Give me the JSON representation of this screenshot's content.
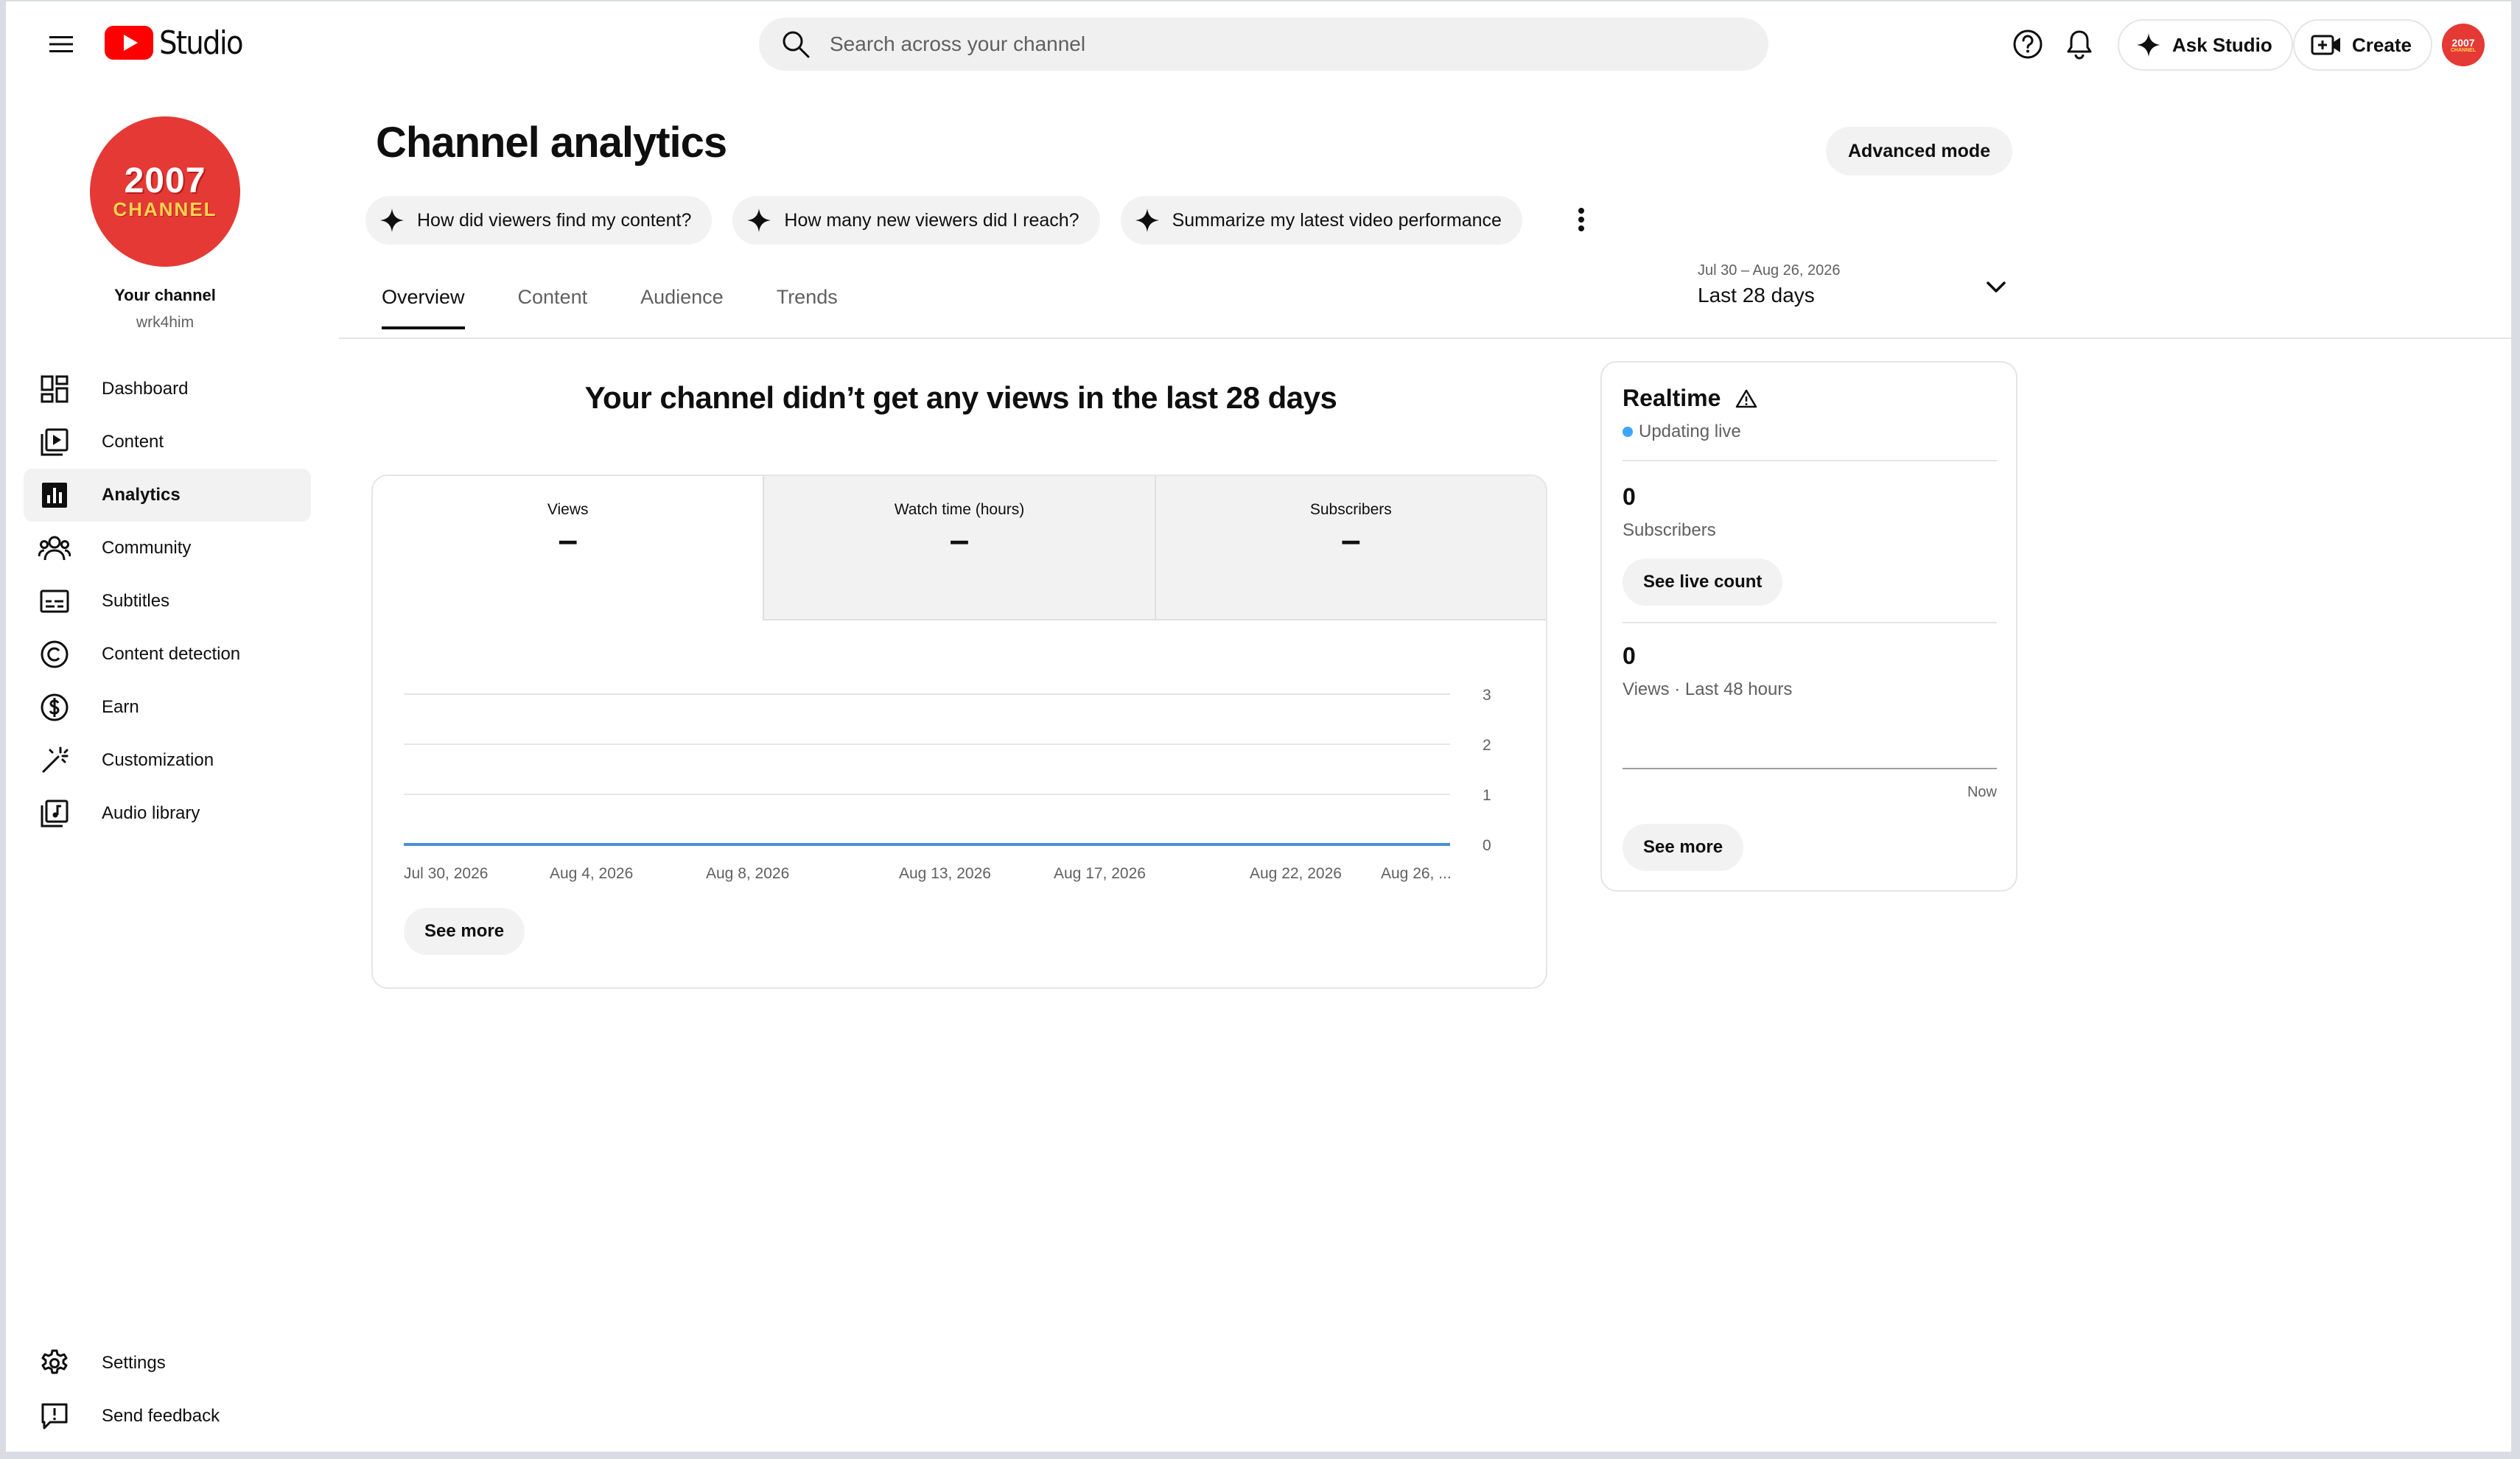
{
  "header": {
    "logo_text": "Studio",
    "search_placeholder": "Search across your channel",
    "ask_studio_label": "Ask Studio",
    "create_label": "Create",
    "avatar_year": "2007",
    "avatar_word": "CHANNEL"
  },
  "sidebar": {
    "channel_label": "Your channel",
    "channel_handle": "wrk4him",
    "avatar_year": "2007",
    "avatar_word": "CHANNEL",
    "items": [
      {
        "label": "Dashboard",
        "icon": "dashboard-icon"
      },
      {
        "label": "Content",
        "icon": "content-icon"
      },
      {
        "label": "Analytics",
        "icon": "analytics-icon",
        "active": true
      },
      {
        "label": "Community",
        "icon": "community-icon"
      },
      {
        "label": "Subtitles",
        "icon": "subtitles-icon"
      },
      {
        "label": "Content detection",
        "icon": "copyright-icon"
      },
      {
        "label": "Earn",
        "icon": "dollar-icon"
      },
      {
        "label": "Customization",
        "icon": "magic-wand-icon"
      },
      {
        "label": "Audio library",
        "icon": "audio-library-icon"
      }
    ],
    "bottom_items": [
      {
        "label": "Settings",
        "icon": "gear-icon"
      },
      {
        "label": "Send feedback",
        "icon": "feedback-icon"
      }
    ]
  },
  "main": {
    "title": "Channel analytics",
    "advanced_mode_label": "Advanced mode",
    "suggestions": [
      "How did viewers find my content?",
      "How many new viewers did I reach?",
      "Summarize my latest video performance"
    ],
    "tabs": [
      {
        "label": "Overview",
        "active": true
      },
      {
        "label": "Content"
      },
      {
        "label": "Audience"
      },
      {
        "label": "Trends"
      }
    ],
    "date_range": "Jul 30 – Aug 26, 2026",
    "date_label": "Last 28 days",
    "headline": "Your channel didn’t get any views in the last 28 days",
    "metrics": [
      {
        "label": "Views",
        "value": "–",
        "active": true
      },
      {
        "label": "Watch time (hours)",
        "value": "–"
      },
      {
        "label": "Subscribers",
        "value": "–"
      }
    ],
    "see_more_label": "See more"
  },
  "chart_data": {
    "type": "line",
    "x": [
      "Jul 30, 2026",
      "Aug 4, 2026",
      "Aug 8, 2026",
      "Aug 13, 2026",
      "Aug 17, 2026",
      "Aug 22, 2026",
      "Aug 26, ..."
    ],
    "series": [
      {
        "values": [
          0,
          0,
          0,
          0,
          0,
          0,
          0
        ]
      }
    ],
    "y_ticks": [
      "0",
      "1",
      "2",
      "3"
    ],
    "ylim": [
      0,
      3
    ],
    "grid": true,
    "line_color": "#4a90d9"
  },
  "realtime": {
    "title": "Realtime",
    "status": "Updating live",
    "subscribers_value": "0",
    "subscribers_label": "Subscribers",
    "live_count_label": "See live count",
    "views_value": "0",
    "views_label": "Views · Last 48 hours",
    "now_label": "Now",
    "see_more_label": "See more"
  },
  "colors": {
    "brand_red": "#ff0000",
    "accent_blue": "#3ea6ff",
    "avatar_red": "#e53935"
  }
}
